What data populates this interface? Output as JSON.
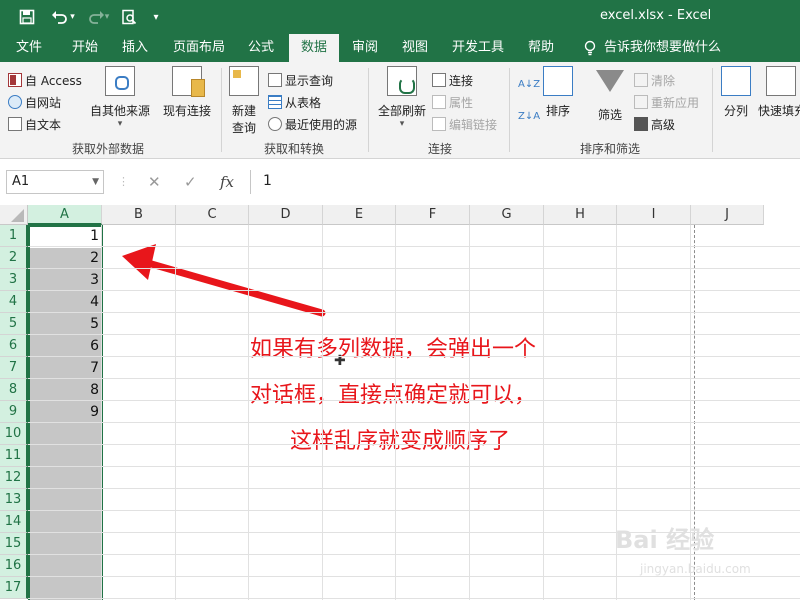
{
  "window": {
    "title": "excel.xlsx  -  Excel"
  },
  "qat": {
    "save_icon": "save-icon",
    "undo_icon": "undo-icon",
    "redo_icon": "redo-icon",
    "preview_icon": "print-preview-icon",
    "customize": "▾"
  },
  "tabs": [
    "文件",
    "开始",
    "插入",
    "页面布局",
    "公式",
    "数据",
    "审阅",
    "视图",
    "开发工具",
    "帮助"
  ],
  "active_tab": "数据",
  "tell_me": "告诉我你想要做什么",
  "ribbon": {
    "get_external": {
      "access": "自 Access",
      "web": "自网站",
      "text": "自文本",
      "other": "自其他来源",
      "existing": "现有连接",
      "label": "获取外部数据"
    },
    "get_transform": {
      "new_query_line1": "新建",
      "new_query_line2": "查询",
      "show_queries": "显示查询",
      "from_table": "从表格",
      "recent_sources": "最近使用的源",
      "label": "获取和转换"
    },
    "connections": {
      "refresh_all": "全部刷新",
      "connections": "连接",
      "properties": "属性",
      "edit_links": "编辑链接",
      "label": "连接"
    },
    "sort_filter": {
      "sort": "排序",
      "filter": "筛选",
      "clear": "清除",
      "reapply": "重新应用",
      "advanced": "高级",
      "label": "排序和筛选"
    },
    "data_tools": {
      "split": "分列",
      "flash_fill": "快速填充"
    }
  },
  "formula_bar": {
    "name_box": "A1",
    "cancel": "✕",
    "enter": "✓",
    "fx": "fx",
    "content": "1"
  },
  "columns": [
    "A",
    "B",
    "C",
    "D",
    "E",
    "F",
    "G",
    "H",
    "I",
    "J"
  ],
  "rows": [
    "1",
    "2",
    "3",
    "4",
    "5",
    "6",
    "7",
    "8",
    "9",
    "10",
    "11",
    "12",
    "13",
    "14",
    "15",
    "16",
    "17"
  ],
  "cells": [
    "1",
    "2",
    "3",
    "4",
    "5",
    "6",
    "7",
    "8",
    "9"
  ],
  "annotation": {
    "line1": "如果有多列数据，会弹出一个",
    "line2": "对话框，直接点确定就可以，",
    "line3": "这样乱序就变成顺序了"
  },
  "watermark": {
    "main": "Bai 经验",
    "sub": "jingyan.baidu.com"
  },
  "colors": {
    "excel_green": "#217346",
    "annotation_red": "#e8161b",
    "selection_gray": "#c6c6c6"
  }
}
